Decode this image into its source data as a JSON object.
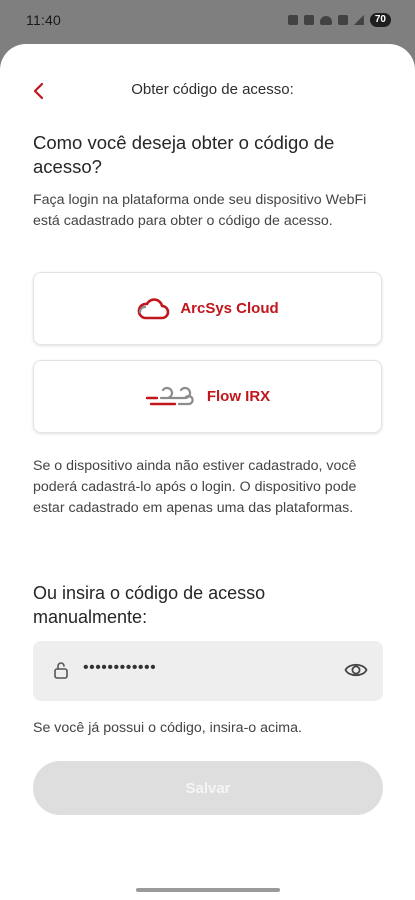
{
  "status_bar": {
    "time": "11:40",
    "battery": "70"
  },
  "header": {
    "title": "Obter código de acesso:"
  },
  "main": {
    "question": "Como você deseja obter o código de acesso?",
    "description": "Faça login na plataforma onde seu dispositivo WebFi está cadastrado para obter o código de acesso.",
    "platforms": [
      {
        "label": "ArcSys Cloud",
        "icon": "cloud-icon"
      },
      {
        "label": "Flow IRX",
        "icon": "wind-icon"
      }
    ],
    "info": "Se o dispositivo ainda não estiver cadastrado, você poderá cadastrá-lo após o login. O dispositivo pode estar cadastrado em apenas uma das plataformas.",
    "manual_heading": "Ou insira o código de acesso manualmente:",
    "code_value": "••••••••••••",
    "hint": "Se você já possui o código, insira-o acima.",
    "save_label": "Salvar"
  },
  "colors": {
    "accent": "#c0161c",
    "field_bg": "#eeeeee",
    "button_disabled": "#dedede"
  }
}
